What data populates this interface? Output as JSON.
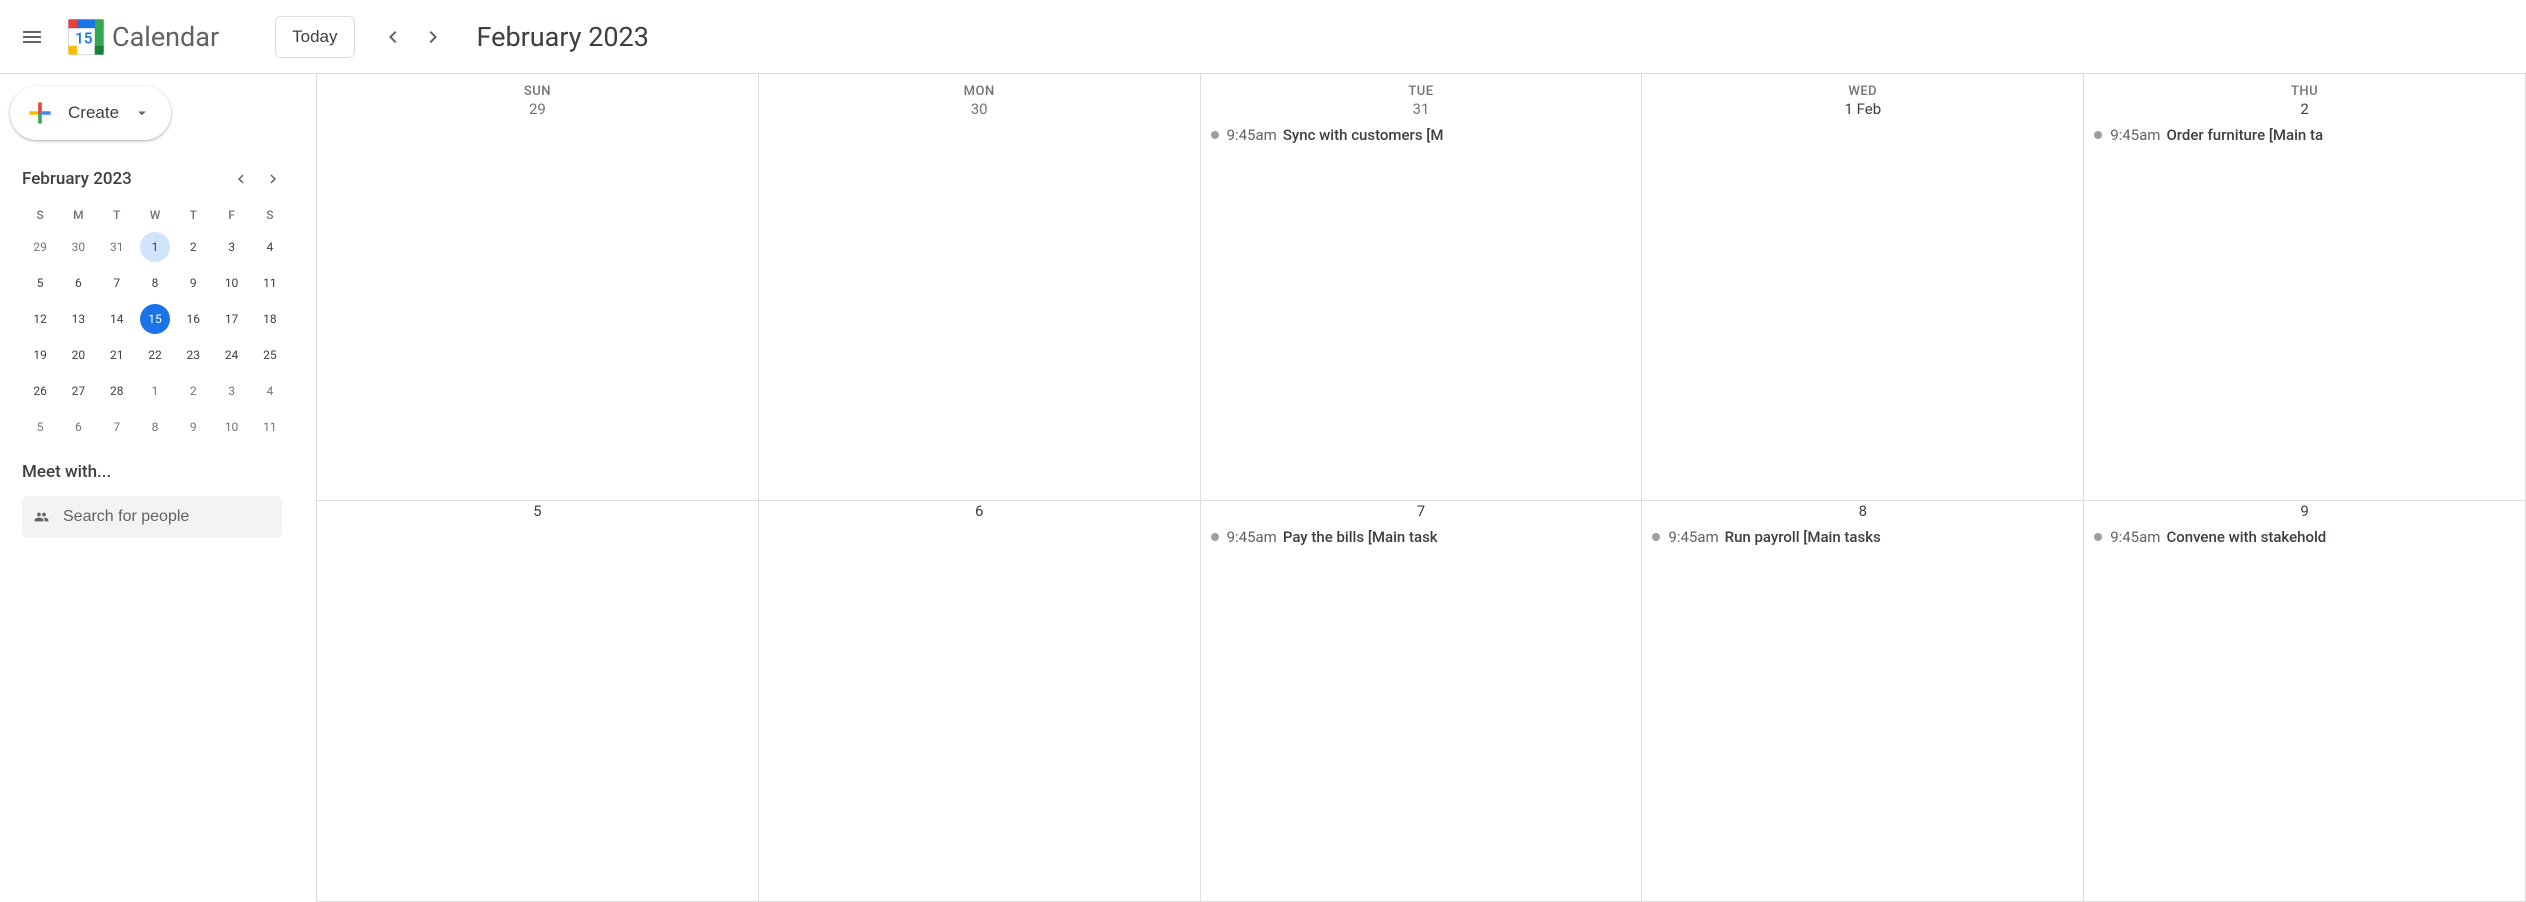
{
  "header": {
    "app_title": "Calendar",
    "today_label": "Today",
    "current_period": "February 2023"
  },
  "create": {
    "label": "Create"
  },
  "mini": {
    "title": "February 2023",
    "dayheads": [
      "S",
      "M",
      "T",
      "W",
      "T",
      "F",
      "S"
    ],
    "weeks": [
      [
        {
          "n": "29",
          "o": true
        },
        {
          "n": "30",
          "o": true
        },
        {
          "n": "31",
          "o": true
        },
        {
          "n": "1",
          "hl": true
        },
        {
          "n": "2"
        },
        {
          "n": "3"
        },
        {
          "n": "4"
        }
      ],
      [
        {
          "n": "5"
        },
        {
          "n": "6"
        },
        {
          "n": "7"
        },
        {
          "n": "8"
        },
        {
          "n": "9"
        },
        {
          "n": "10"
        },
        {
          "n": "11"
        }
      ],
      [
        {
          "n": "12"
        },
        {
          "n": "13"
        },
        {
          "n": "14"
        },
        {
          "n": "15",
          "today": true
        },
        {
          "n": "16"
        },
        {
          "n": "17"
        },
        {
          "n": "18"
        }
      ],
      [
        {
          "n": "19"
        },
        {
          "n": "20"
        },
        {
          "n": "21"
        },
        {
          "n": "22"
        },
        {
          "n": "23"
        },
        {
          "n": "24"
        },
        {
          "n": "25"
        }
      ],
      [
        {
          "n": "26"
        },
        {
          "n": "27"
        },
        {
          "n": "28"
        },
        {
          "n": "1",
          "o": true
        },
        {
          "n": "2",
          "o": true
        },
        {
          "n": "3",
          "o": true
        },
        {
          "n": "4",
          "o": true
        }
      ],
      [
        {
          "n": "5",
          "o": true
        },
        {
          "n": "6",
          "o": true
        },
        {
          "n": "7",
          "o": true
        },
        {
          "n": "8",
          "o": true
        },
        {
          "n": "9",
          "o": true
        },
        {
          "n": "10",
          "o": true
        },
        {
          "n": "11",
          "o": true
        }
      ]
    ]
  },
  "meet": {
    "title": "Meet with...",
    "placeholder": "Search for people"
  },
  "grid": {
    "weekdays": [
      "SUN",
      "MON",
      "TUE",
      "WED",
      "THU"
    ],
    "rows": [
      [
        {
          "num": "29",
          "other": true,
          "events": []
        },
        {
          "num": "30",
          "other": true,
          "events": []
        },
        {
          "num": "31",
          "other": true,
          "events": [
            {
              "time": "9:45am",
              "title": "Sync with customers [M"
            }
          ]
        },
        {
          "num": "1 Feb",
          "events": []
        },
        {
          "num": "2",
          "events": [
            {
              "time": "9:45am",
              "title": "Order furniture [Main ta"
            }
          ]
        }
      ],
      [
        {
          "num": "5",
          "events": []
        },
        {
          "num": "6",
          "events": []
        },
        {
          "num": "7",
          "events": [
            {
              "time": "9:45am",
              "title": "Pay the bills [Main task"
            }
          ]
        },
        {
          "num": "8",
          "events": [
            {
              "time": "9:45am",
              "title": "Run payroll [Main tasks"
            }
          ]
        },
        {
          "num": "9",
          "events": [
            {
              "time": "9:45am",
              "title": "Convene with stakehold"
            }
          ]
        }
      ]
    ]
  }
}
